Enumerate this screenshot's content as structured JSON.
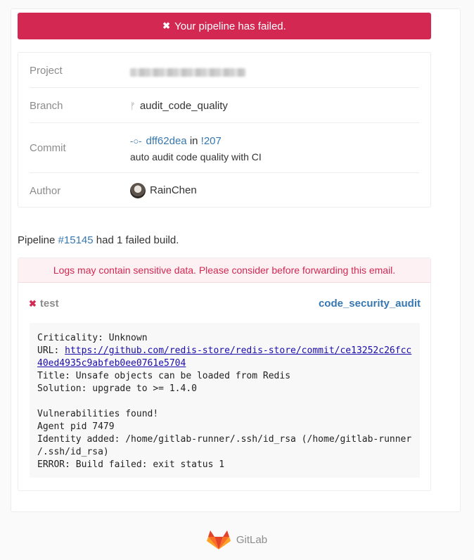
{
  "banner": {
    "icon": "✖",
    "text": "Your pipeline has failed."
  },
  "info": {
    "project_label": "Project",
    "branch_label": "Branch",
    "branch_value": "audit_code_quality",
    "commit_label": "Commit",
    "commit_sha": "dff62dea",
    "commit_in": "in",
    "commit_mr": "!207",
    "commit_message": "auto audit code quality with CI",
    "author_label": "Author",
    "author_name": "RainChen"
  },
  "pipeline": {
    "prefix": "Pipeline",
    "id": "#15145",
    "suffix": "had 1 failed build."
  },
  "build": {
    "warning": "Logs may contain sensitive data. Please consider before forwarding this email.",
    "name": "test",
    "stage": "code_security_audit",
    "log": {
      "line1": "Criticality: Unknown",
      "url_prefix": "URL: ",
      "url_part1": "https://github.com/redis-store/redis-store/commit/ce13252c26fcc",
      "url_part2": "40ed4935c9abfeb0ee0761e5704",
      "line3": "Title: Unsafe objects can be loaded from Redis",
      "line4": "Solution: upgrade to >= 1.4.0",
      "line5": "",
      "line6": "Vulnerabilities found!",
      "line7": "Agent pid 7479",
      "line8": "Identity added: /home/gitlab-runner/.ssh/id_rsa (/home/gitlab-runner",
      "line9": "/.ssh/id_rsa)",
      "line10": "ERROR: Build failed: exit status 1"
    }
  },
  "footer": {
    "brand": "GitLab"
  },
  "colors": {
    "danger": "#d22852",
    "link": "#3777b0",
    "muted": "#8c8c8c"
  }
}
